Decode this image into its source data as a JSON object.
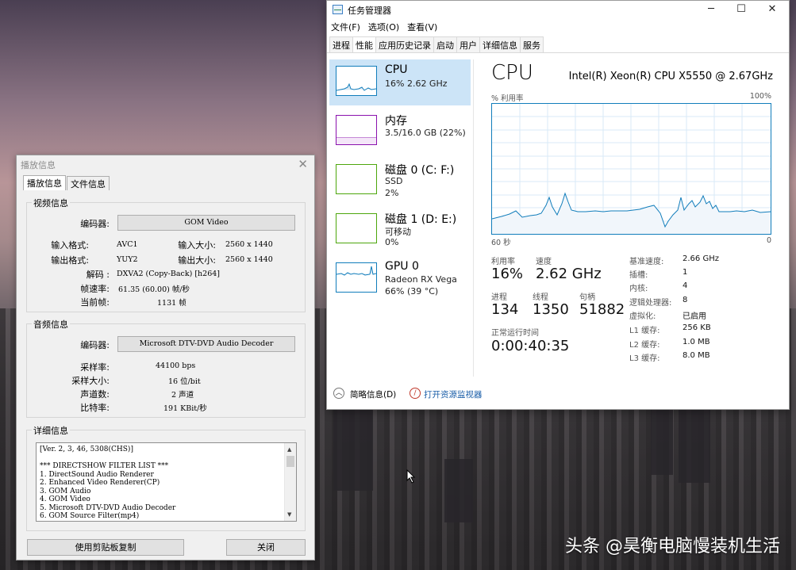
{
  "watermark": "头条 @昊衡电脑慢装机生活",
  "gom": {
    "title": "播放信息",
    "tabs": [
      "播放信息",
      "文件信息"
    ],
    "video": {
      "group": "视频信息",
      "codec_label": "编码器:",
      "codec_value": "GOM Video",
      "in_format_label": "输入格式:",
      "in_format_value": "AVC1",
      "in_size_label": "输入大小:",
      "in_size_value": "2560 x 1440",
      "out_format_label": "输出格式:",
      "out_format_value": "YUY2",
      "out_size_label": "输出大小:",
      "out_size_value": "2560 x 1440",
      "decode_label": "解码 :",
      "decode_value": "DXVA2 (Copy-Back) [h264]",
      "fps_label": "帧速率:",
      "fps_value": "61.35 (60.00) 帧/秒",
      "cur_frame_label": "当前帧:",
      "cur_frame_value": "1131 帧"
    },
    "audio": {
      "group": "音频信息",
      "codec_label": "编码器:",
      "codec_value": "Microsoft DTV-DVD Audio Decoder",
      "samplerate_label": "采样率:",
      "samplerate_value": "44100 bps",
      "samplesize_label": "采样大小:",
      "samplesize_value": "16 位/bit",
      "channels_label": "声道数:",
      "channels_value": "2 声道",
      "bitrate_label": "比特率:",
      "bitrate_value": "191 KBit/秒"
    },
    "detail": {
      "group": "详细信息",
      "lines": [
        "[Ver. 2, 3, 46, 5308(CHS)]",
        "",
        "*** DIRECTSHOW FILTER LIST ***",
        "1. DirectSound Audio Renderer",
        "2. Enhanced Video Renderer(CP)",
        "3. GOM Audio",
        "4. GOM Video",
        "5. Microsoft DTV-DVD Audio Decoder",
        "6. GOM Source Filter(mp4)"
      ]
    },
    "copy_button": "使用剪贴板复制",
    "close_button": "关闭"
  },
  "taskmgr": {
    "title": "任务管理器",
    "menu": [
      "文件(F)",
      "选项(O)",
      "查看(V)"
    ],
    "tabs": [
      "进程",
      "性能",
      "应用历史记录",
      "启动",
      "用户",
      "详细信息",
      "服务"
    ],
    "active_tab": "性能",
    "sidebar": [
      {
        "name": "CPU",
        "lines": [
          "16% 2.62 GHz"
        ],
        "color": "#117dbb"
      },
      {
        "name": "内存",
        "lines": [
          "3.5/16.0 GB (22%)"
        ],
        "color": "#8b12ae"
      },
      {
        "name": "磁盘 0 (C: F:)",
        "lines": [
          "SSD",
          "2%"
        ],
        "color": "#4da60c"
      },
      {
        "name": "磁盘 1 (D: E:)",
        "lines": [
          "可移动",
          "0%"
        ],
        "color": "#4da60c"
      },
      {
        "name": "GPU 0",
        "lines": [
          "Radeon RX Vega",
          "66% (39 °C)"
        ],
        "color": "#117dbb"
      }
    ],
    "main": {
      "title": "CPU",
      "cpu_name": "Intel(R) Xeon(R) CPU X5550 @ 2.67GHz",
      "graph_label": "% 利用率",
      "graph_max": "100%",
      "graph_time": "60 秒",
      "graph_min": "0",
      "utilization_label": "利用率",
      "utilization": "16%",
      "speed_label": "速度",
      "speed": "2.62 GHz",
      "processes_label": "进程",
      "processes": "134",
      "threads_label": "线程",
      "threads": "1350",
      "handles_label": "句柄",
      "handles": "51882",
      "uptime_label": "正常运行时间",
      "uptime": "0:00:40:35",
      "specs": [
        {
          "label": "基准速度:",
          "value": "2.66 GHz"
        },
        {
          "label": "插槽:",
          "value": "1"
        },
        {
          "label": "内核:",
          "value": "4"
        },
        {
          "label": "逻辑处理器:",
          "value": "8"
        },
        {
          "label": "虚拟化:",
          "value": "已启用"
        },
        {
          "label": "L1 缓存:",
          "value": "256 KB"
        },
        {
          "label": "L2 缓存:",
          "value": "1.0 MB"
        },
        {
          "label": "L3 缓存:",
          "value": "8.0 MB"
        }
      ]
    },
    "footer": {
      "fewer_details": "简略信息(D)",
      "resource_monitor": "打开资源监视器"
    }
  }
}
